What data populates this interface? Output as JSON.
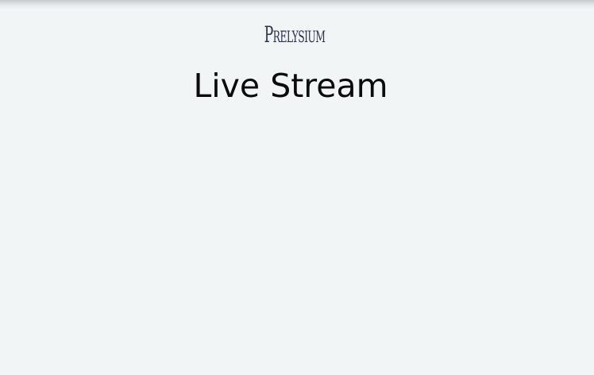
{
  "header": {
    "brand": "Prelysium",
    "title": "Live Stream"
  },
  "colors": {
    "background": "#f2f5f6",
    "brand": "#2d3152",
    "title": "#0b0b0d"
  }
}
